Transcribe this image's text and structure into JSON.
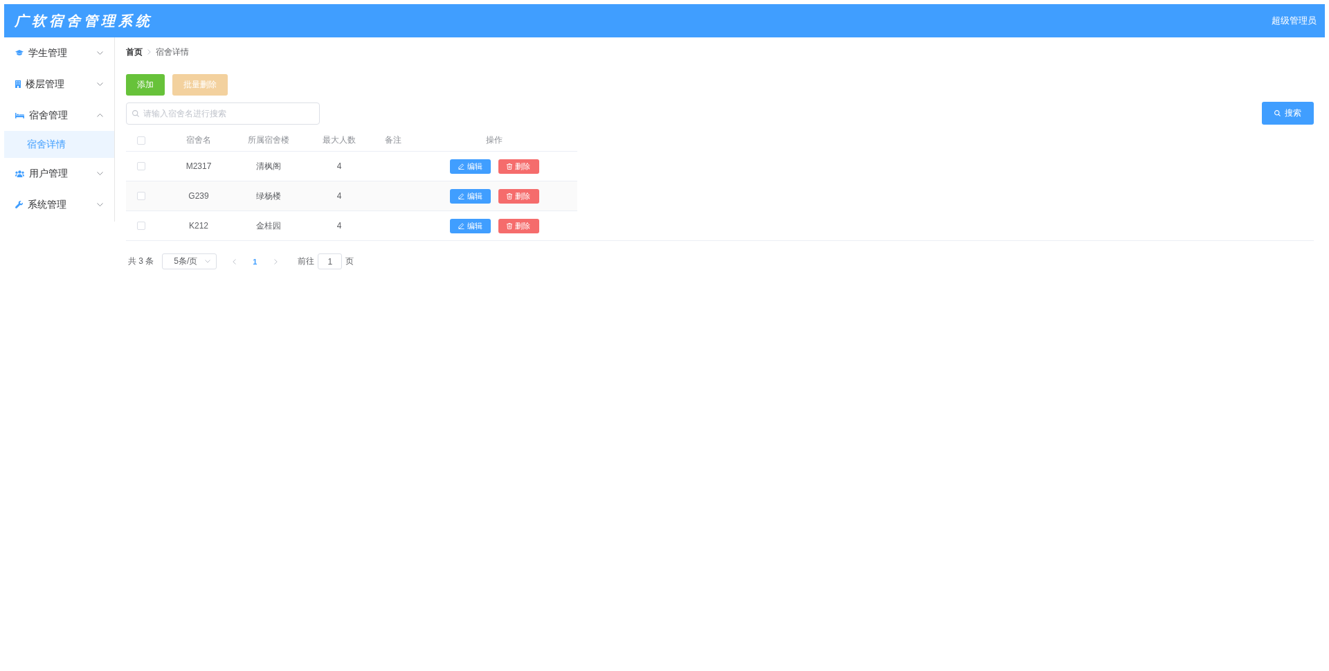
{
  "header": {
    "title": "广软宿舍管理系统",
    "user": "超级管理员"
  },
  "sidebar": {
    "items": [
      {
        "label": "学生管理",
        "expanded": false
      },
      {
        "label": "楼层管理",
        "expanded": false
      },
      {
        "label": "宿舍管理",
        "expanded": true,
        "children": [
          {
            "label": "宿舍详情",
            "selected": true
          }
        ]
      },
      {
        "label": "用户管理",
        "expanded": false
      },
      {
        "label": "系统管理",
        "expanded": false
      }
    ]
  },
  "breadcrumb": [
    {
      "label": "首页"
    },
    {
      "label": "宿舍详情"
    }
  ],
  "toolbar": {
    "buttons": [
      {
        "label": "添加",
        "kind": "success",
        "disabled": false
      },
      {
        "label": "批量删除",
        "kind": "warning",
        "disabled": true
      }
    ]
  },
  "search": {
    "placeholder": "请输入宿舍名进行搜索",
    "button": "搜索"
  },
  "table": {
    "stripe": true,
    "select_all": {
      "checked": false
    },
    "columns": [
      "宿舍名",
      "所属宿舍楼",
      "最大人数",
      "备注",
      "操作"
    ],
    "rows": [
      {
        "checked": false,
        "name": "M2317",
        "building": "清枫阁",
        "capacity": "4",
        "actions": [
          {
            "label": "编辑",
            "kind": "edit"
          },
          {
            "label": "删除",
            "kind": "delete"
          }
        ]
      },
      {
        "checked": false,
        "name": "G239",
        "building": "绿杨楼",
        "capacity": "4",
        "actions": [
          {
            "label": "编辑",
            "kind": "edit"
          },
          {
            "label": "删除",
            "kind": "delete"
          }
        ]
      },
      {
        "checked": false,
        "name": "K212",
        "building": "金桂园",
        "capacity": "4",
        "actions": [
          {
            "label": "编辑",
            "kind": "edit"
          },
          {
            "label": "删除",
            "kind": "delete"
          }
        ]
      }
    ]
  },
  "pagination": {
    "total": "共 3 条",
    "page_size": "5条/页",
    "prev_disabled": true,
    "pages": [
      {
        "label": "1",
        "selected": true
      }
    ],
    "next_disabled": true,
    "jump_label": "前往",
    "jump_value": "1",
    "jump_suffix": "页"
  }
}
